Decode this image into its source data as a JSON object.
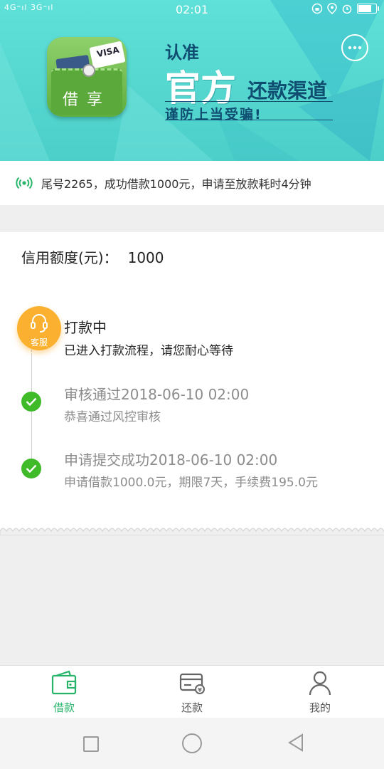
{
  "status_bar": {
    "signal": "4G⁼ıl 3G⁼ıl",
    "time": "02:01"
  },
  "banner": {
    "app_icon_text": "借享",
    "app_icon_card": "VISA",
    "slogan_line1": "认准",
    "slogan_line2": "官方",
    "slogan_line2b": "还款渠道",
    "slogan_line3": "谨防上当受骗!",
    "chat_icon": "more-dots-icon"
  },
  "notice": {
    "icon": "broadcast-icon",
    "text": "尾号2265，成功借款1000元，申请至放款耗时4分钟"
  },
  "credit": {
    "label": "信用额度(元)：",
    "value": "1000"
  },
  "timeline": {
    "service_label": "客服",
    "steps": [
      {
        "title": "打款中",
        "subtitle": "已进入打款流程，请您耐心等待",
        "state": "active"
      },
      {
        "title": "审核通过2018-06-10 02:00",
        "subtitle": "恭喜通过风控审核",
        "state": "done"
      },
      {
        "title": "申请提交成功2018-06-10 02:00",
        "subtitle": "申请借款1000.0元，期限7天，手续费195.0元",
        "state": "done"
      }
    ]
  },
  "tabs": [
    {
      "label": "借款",
      "icon": "wallet-icon",
      "active": true
    },
    {
      "label": "还款",
      "icon": "card-icon",
      "active": false
    },
    {
      "label": "我的",
      "icon": "person-icon",
      "active": false
    }
  ],
  "colors": {
    "banner": "#55d8d0",
    "accent_green": "#27b46a",
    "check_green": "#3fbb2a",
    "service_orange": "#fbb12f"
  }
}
